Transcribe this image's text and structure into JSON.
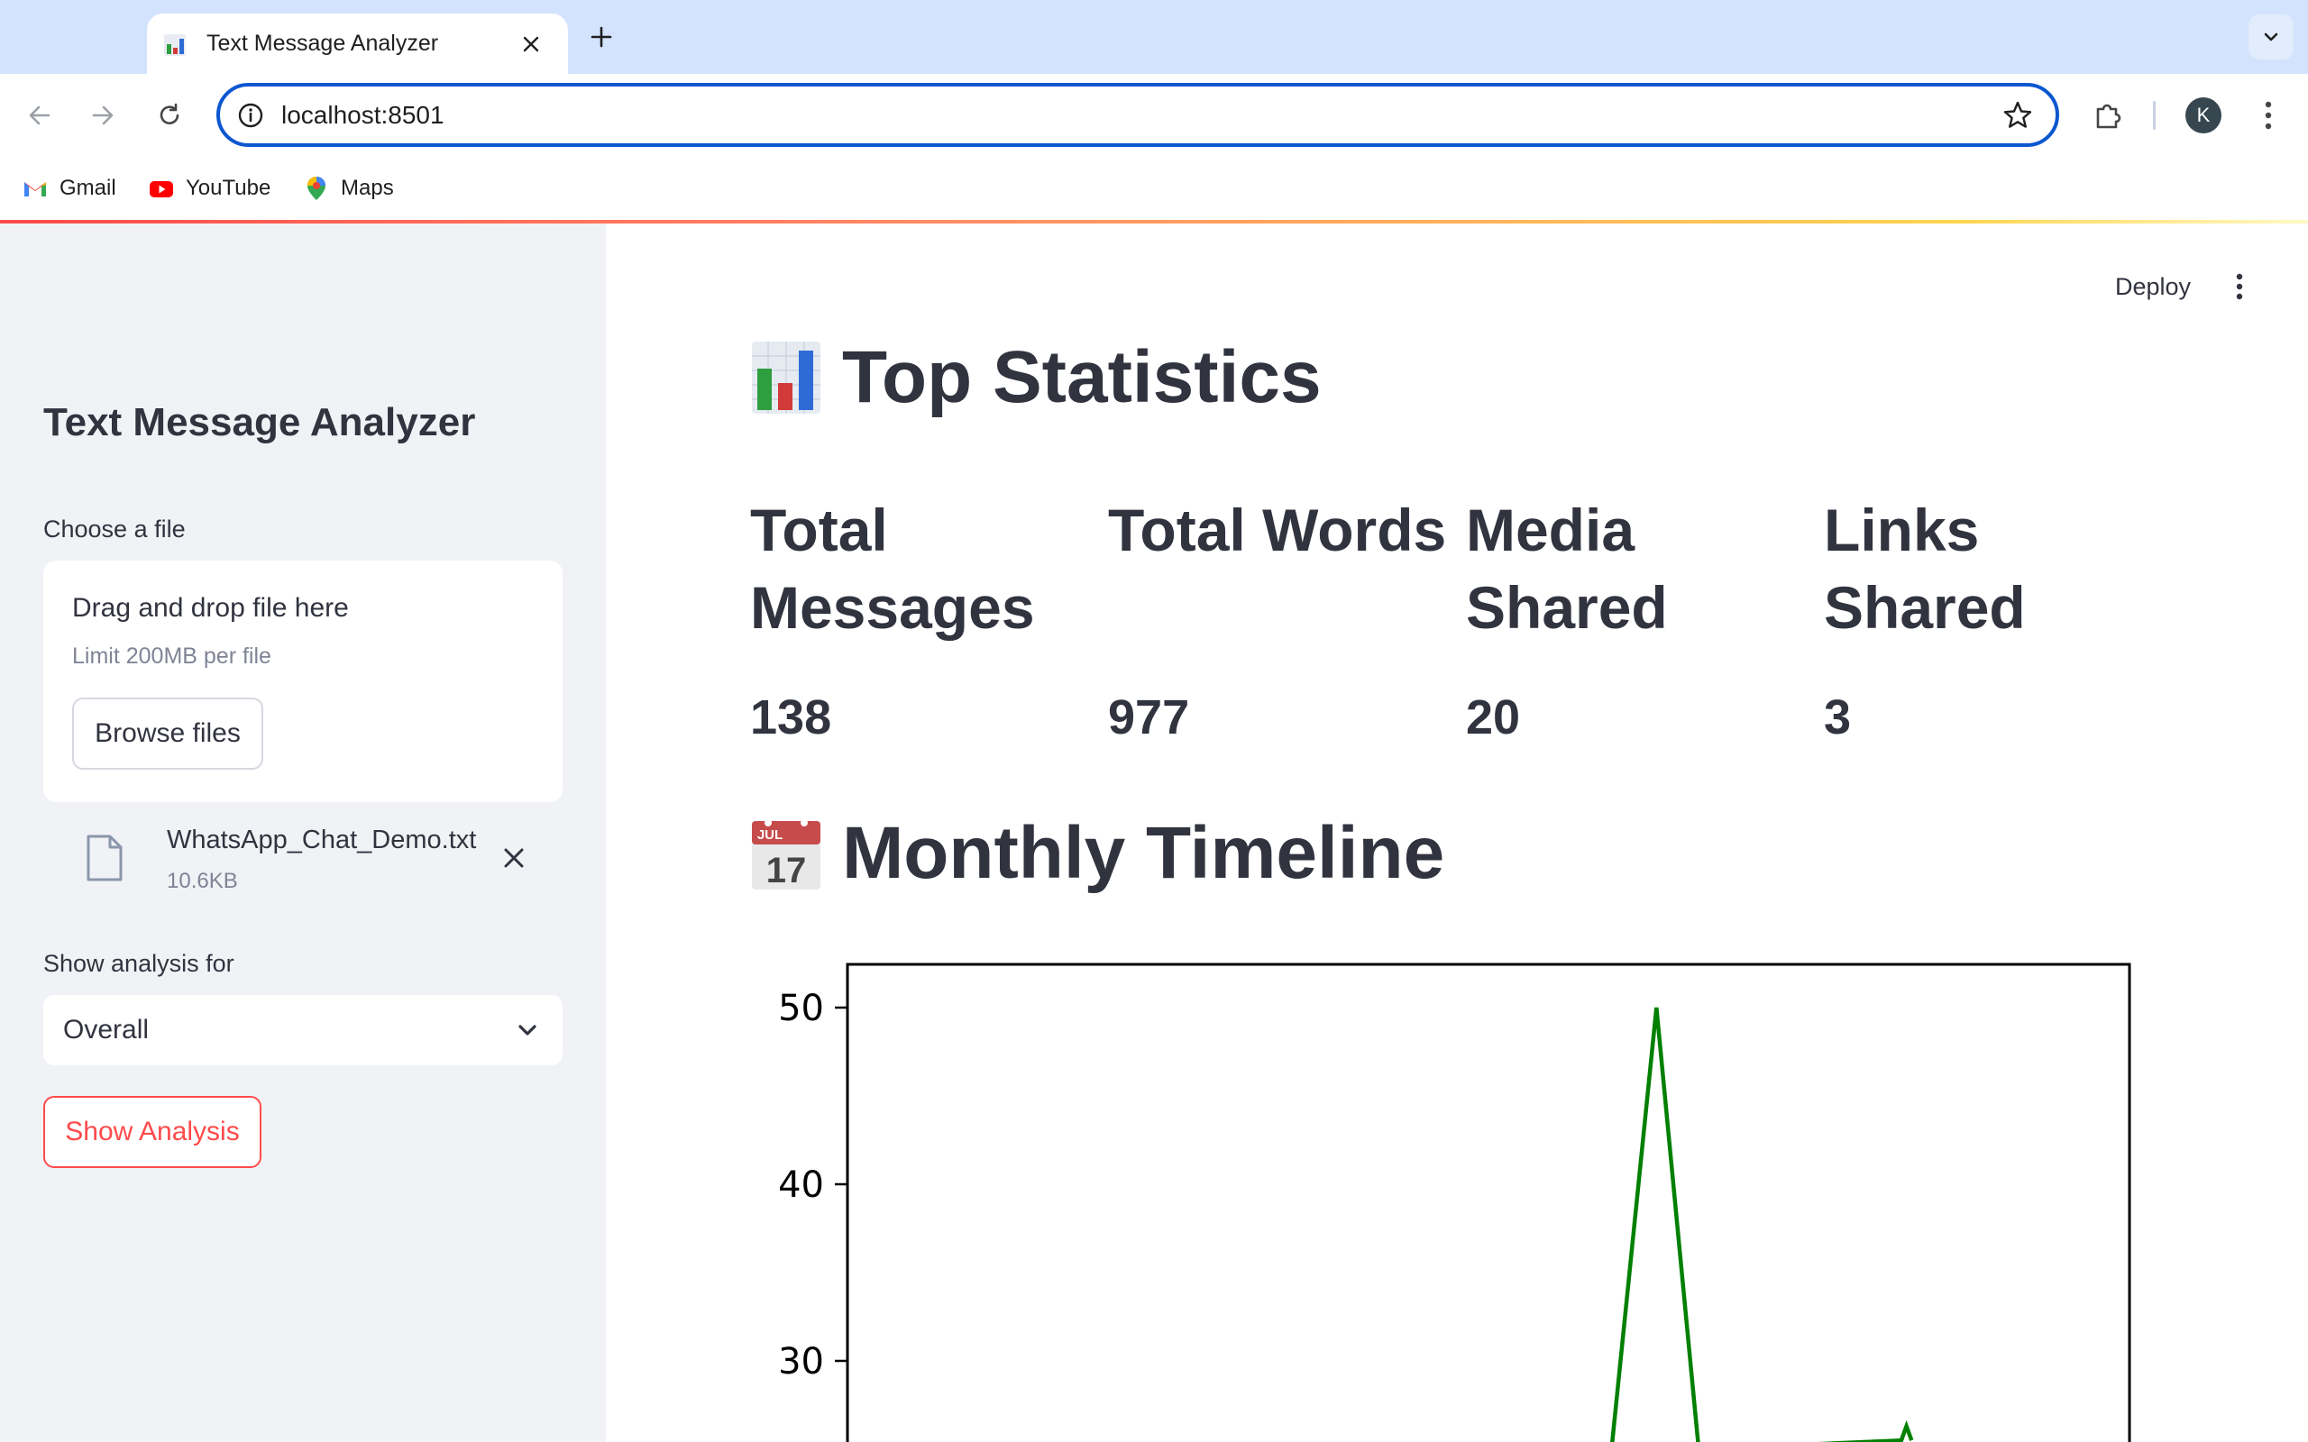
{
  "browser": {
    "tab_title": "Text Message Analyzer",
    "url": "localhost:8501",
    "profile_initial": "K",
    "bookmarks": [
      {
        "label": "Gmail",
        "icon": "gmail-icon"
      },
      {
        "label": "YouTube",
        "icon": "youtube-icon"
      },
      {
        "label": "Maps",
        "icon": "maps-icon"
      }
    ]
  },
  "sidebar": {
    "title": "Text Message Analyzer",
    "upload_label": "Choose a file",
    "dropzone_text": "Drag and drop file here",
    "dropzone_limit": "Limit 200MB per file",
    "browse_button": "Browse files",
    "file": {
      "name": "WhatsApp_Chat_Demo.txt",
      "size": "10.6KB"
    },
    "select_label": "Show analysis for",
    "select_value": "Overall",
    "analyze_button": "Show Analysis"
  },
  "header": {
    "deploy_label": "Deploy"
  },
  "main": {
    "top_stats_heading": "Top Statistics",
    "metrics": [
      {
        "label": "Total Messages",
        "value": "138"
      },
      {
        "label": "Total Words",
        "value": "977"
      },
      {
        "label": "Media Shared",
        "value": "20"
      },
      {
        "label": "Links Shared",
        "value": "3"
      }
    ],
    "timeline_heading": "Monthly Timeline",
    "emoji_calendar": {
      "month": "JUL",
      "day": "17"
    }
  },
  "colors": {
    "accent": "#ff4b4b",
    "text": "#31333f",
    "sidebar_bg": "#f0f2f6",
    "line": "#008000"
  },
  "chart_data": {
    "type": "line",
    "title": "",
    "xlabel": "",
    "ylabel": "",
    "y_ticks": [
      30,
      40,
      50
    ],
    "ylim_visible": [
      25.5,
      52.5
    ],
    "series": [
      {
        "color": "#008000",
        "points": [
          {
            "x": 0.0,
            "y": 25.0
          },
          {
            "x": 0.596,
            "y": 25.0
          },
          {
            "x": 0.631,
            "y": 50.0
          },
          {
            "x": 0.664,
            "y": 25.0
          },
          {
            "x": 0.822,
            "y": 25.5
          },
          {
            "x": 0.826,
            "y": 26.3
          },
          {
            "x": 0.83,
            "y": 25.5
          }
        ]
      }
    ]
  }
}
